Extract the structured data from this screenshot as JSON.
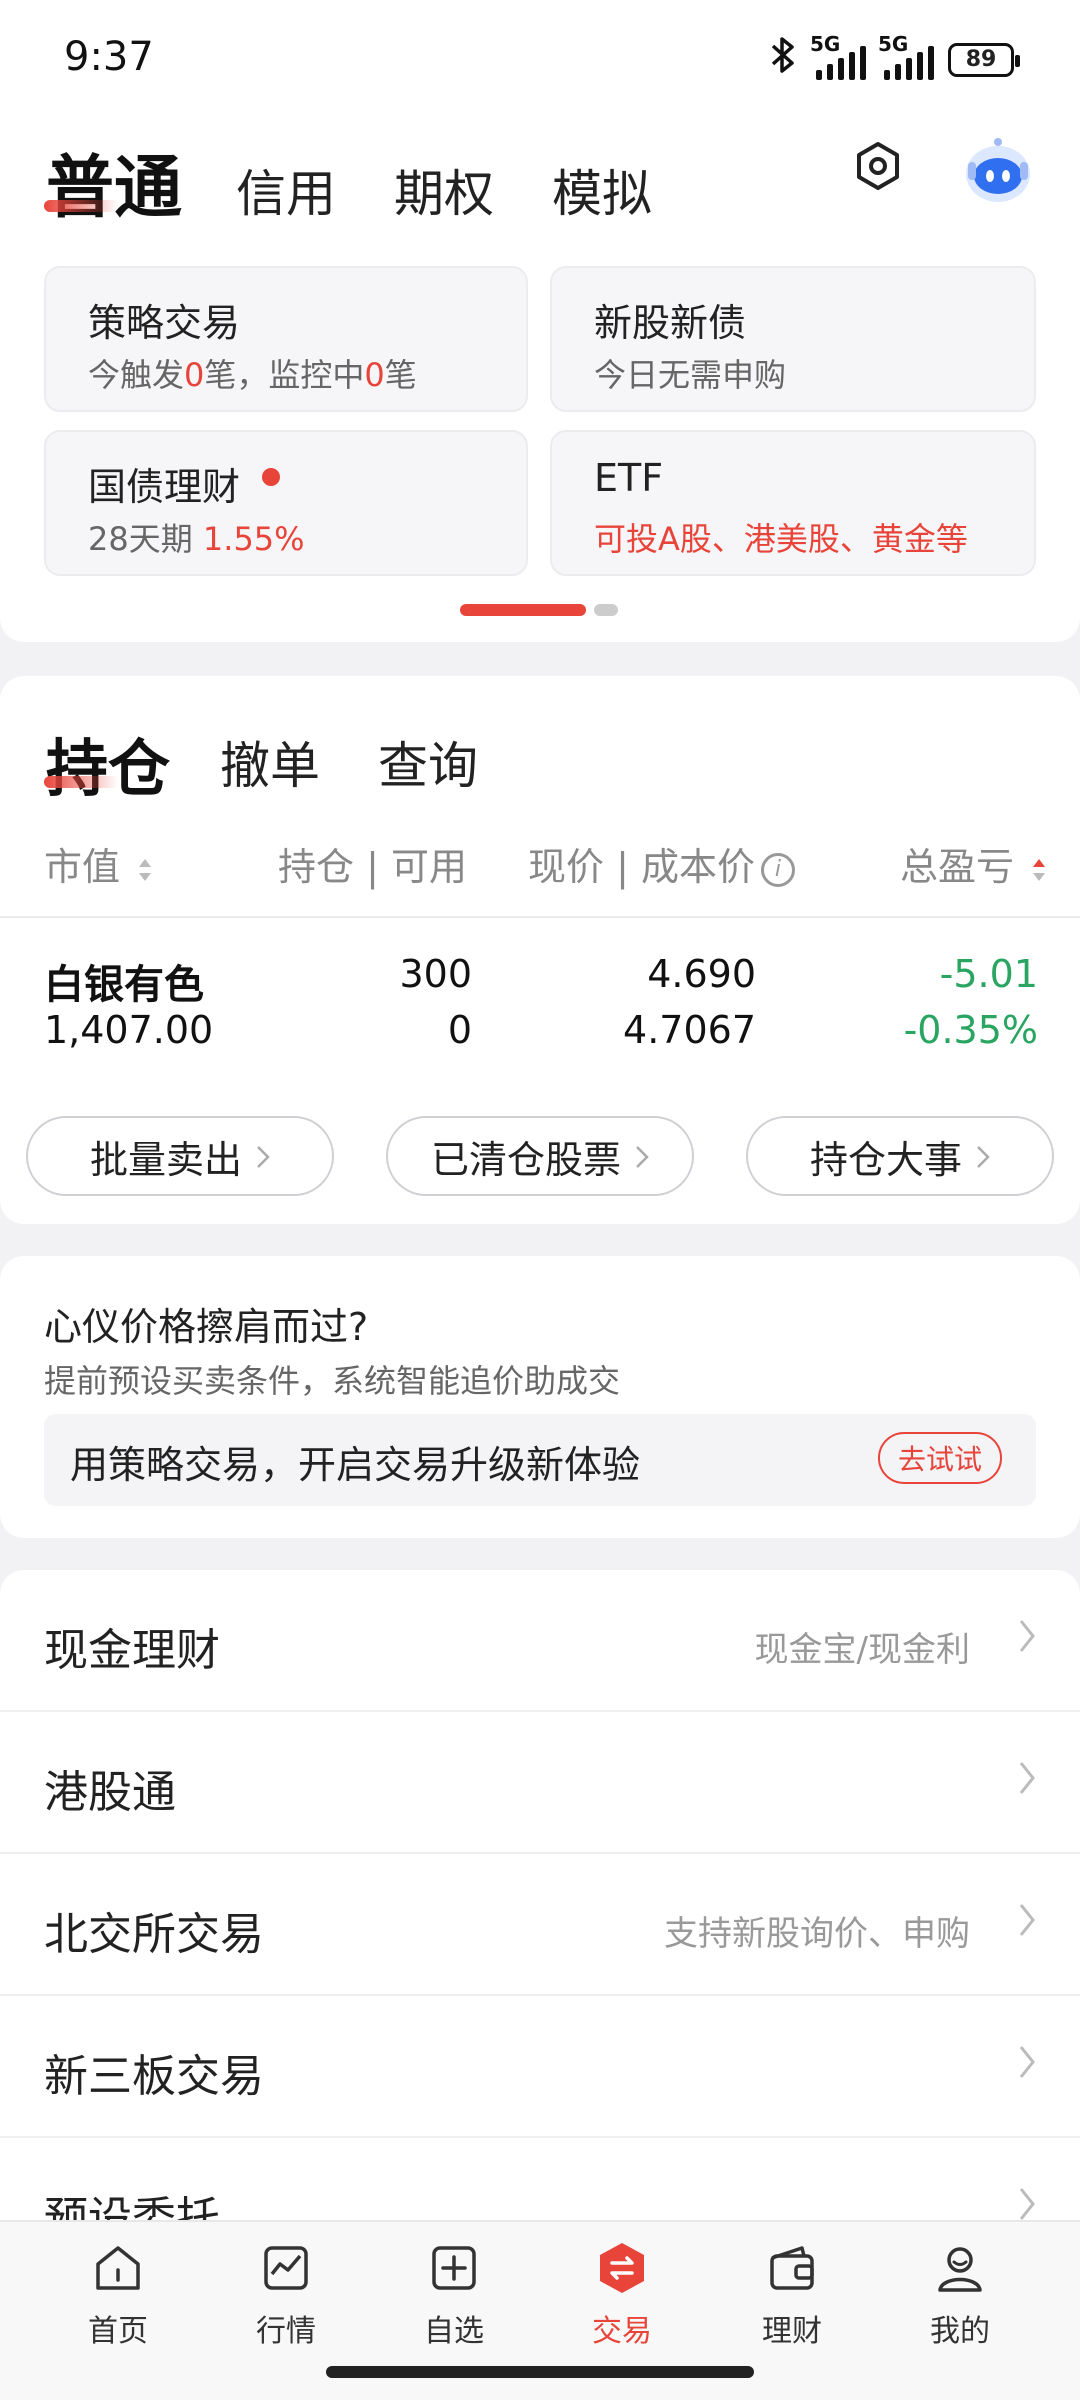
{
  "status_bar": {
    "time": "9:37",
    "net1": "5G",
    "net2": "5G",
    "battery": "89"
  },
  "top_tabs": [
    {
      "label": "普通",
      "active": true
    },
    {
      "label": "信用",
      "active": false
    },
    {
      "label": "期权",
      "active": false
    },
    {
      "label": "模拟",
      "active": false
    }
  ],
  "cards": {
    "strategy": {
      "title": "策略交易",
      "sub_a": "今触发",
      "sub_n1": "0",
      "sub_b": "笔，监控中",
      "sub_n2": "0",
      "sub_c": "笔"
    },
    "ipo": {
      "title": "新股新债",
      "sub": "今日无需申购"
    },
    "bond": {
      "title": "国债理财",
      "sub": "28天期",
      "rate": "1.55%"
    },
    "etf": {
      "title": "ETF",
      "sub": "可投A股、港美股、黄金等"
    }
  },
  "holdings": {
    "tabs": [
      "持仓",
      "撤单",
      "查询"
    ],
    "headers": {
      "market_value": "市值",
      "position": "持仓 | 可用",
      "price": "现价 | 成本价",
      "pnl": "总盈亏"
    },
    "rows": [
      {
        "name": "白银有色",
        "market_value": "1,407.00",
        "position": "300",
        "available": "0",
        "price": "4.690",
        "cost": "4.7067",
        "pnl": "-5.01",
        "pnl_pct": "-0.35%"
      }
    ],
    "buttons": [
      "批量卖出",
      "已清仓股票",
      "持仓大事"
    ]
  },
  "promo": {
    "title": "心仪价格擦肩而过?",
    "sub": "提前预设买卖条件，系统智能追价助成交",
    "box_text": "用策略交易，开启交易升级新体验",
    "try_label": "去试试"
  },
  "menu": [
    {
      "label": "现金理财",
      "right": "现金宝/现金利"
    },
    {
      "label": "港股通",
      "right": ""
    },
    {
      "label": "北交所交易",
      "right": "支持新股询价、申购"
    },
    {
      "label": "新三板交易",
      "right": ""
    },
    {
      "label": "预设委托",
      "right": ""
    }
  ],
  "bottom_nav": [
    {
      "label": "首页",
      "icon": "home-icon"
    },
    {
      "label": "行情",
      "icon": "chart-icon"
    },
    {
      "label": "自选",
      "icon": "add-square-icon"
    },
    {
      "label": "交易",
      "icon": "trade-icon",
      "active": true
    },
    {
      "label": "理财",
      "icon": "wallet-icon"
    },
    {
      "label": "我的",
      "icon": "profile-icon"
    }
  ],
  "colors": {
    "accent": "#e8443a",
    "loss": "#2aa561",
    "muted": "#888888"
  }
}
